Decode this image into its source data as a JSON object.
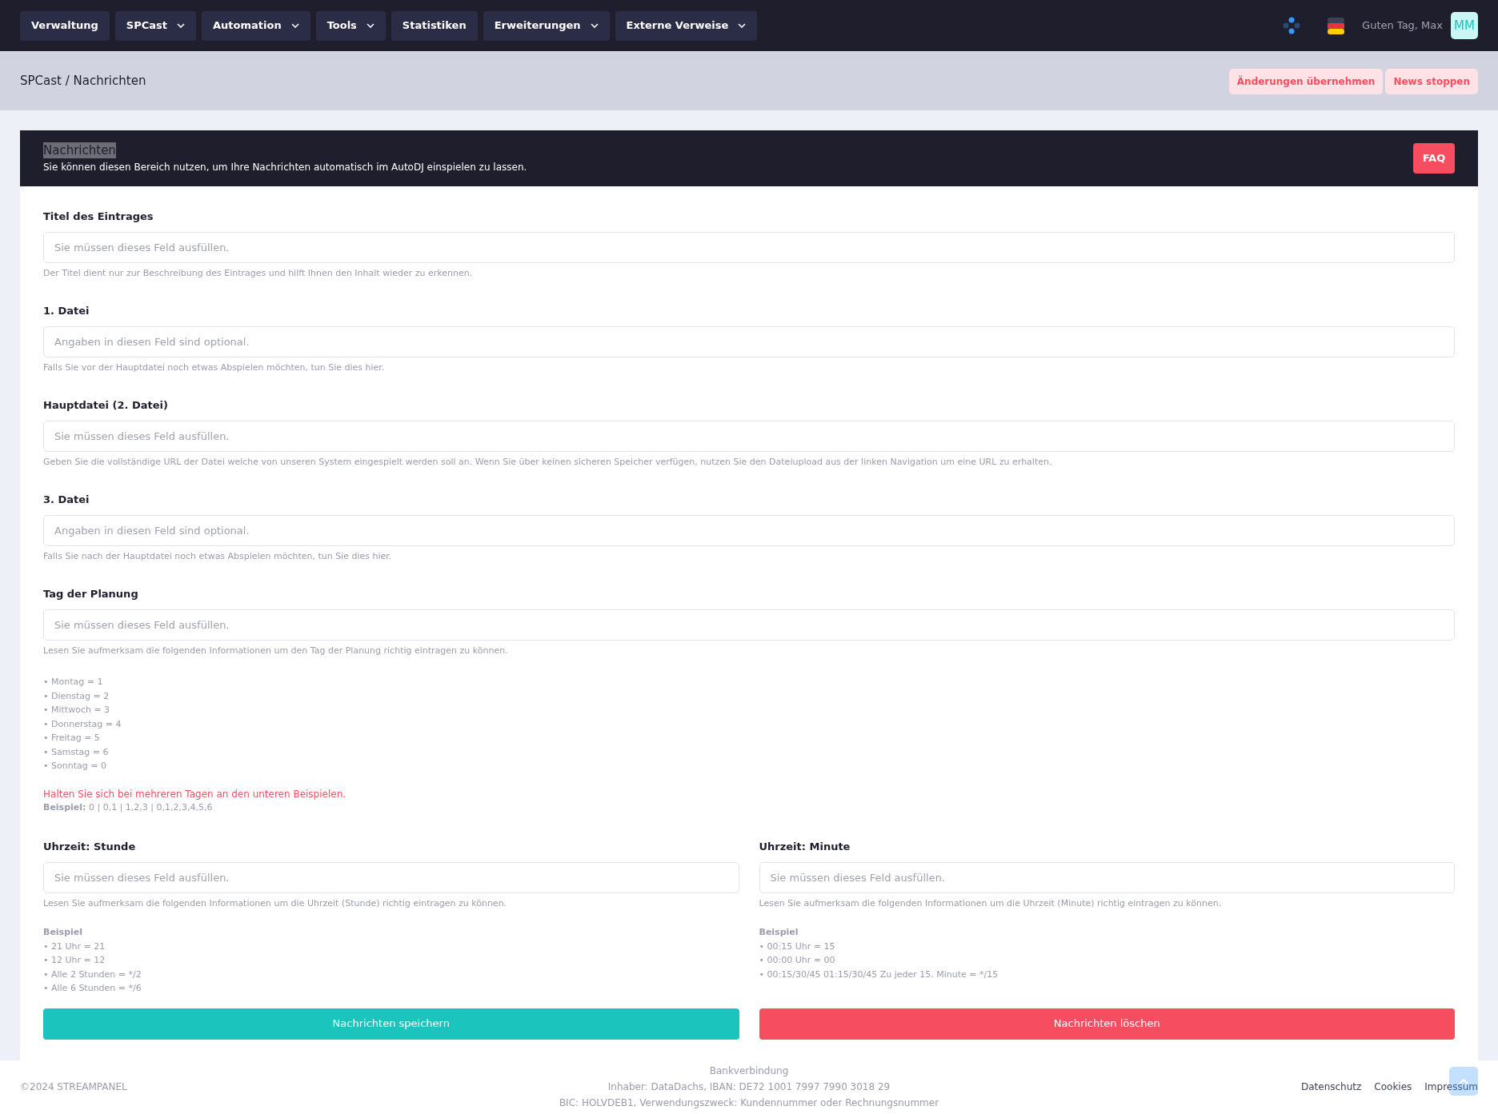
{
  "nav": {
    "items": [
      {
        "label": "Verwaltung",
        "dropdown": false
      },
      {
        "label": "SPCast",
        "dropdown": true
      },
      {
        "label": "Automation",
        "dropdown": true
      },
      {
        "label": "Tools",
        "dropdown": true
      },
      {
        "label": "Statistiken",
        "dropdown": false
      },
      {
        "label": "Erweiterungen",
        "dropdown": true
      },
      {
        "label": "Externe Verweise",
        "dropdown": true
      }
    ],
    "greeting": "Guten Tag, Max",
    "avatar": "MM"
  },
  "breadcrumb": "SPCast / Nachrichten",
  "actions": [
    "Änderungen übernehmen",
    "News stoppen"
  ],
  "card": {
    "title": "Nachrichten",
    "title_highlighted": true,
    "subtitle": "Sie können diesen Bereich nutzen, um Ihre Nachrichten automatisch im AutoDJ einspielen zu lassen.",
    "faq": "FAQ"
  },
  "fields": [
    {
      "label": "Titel des Eintrages",
      "placeholder": "Sie müssen dieses Feld ausfüllen.",
      "help": "Der Titel dient nur zur Beschreibung des Eintrages und hilft Ihnen den Inhalt wieder zu erkennen."
    },
    {
      "label": "1. Datei",
      "placeholder": "Angaben in diesen Feld sind optional.",
      "help": "Falls Sie vor der Hauptdatei noch etwas Abspielen möchten, tun Sie dies hier."
    },
    {
      "label": "Hauptdatei (2. Datei)",
      "placeholder": "Sie müssen dieses Feld ausfüllen.",
      "help": "Geben Sie die vollständige URL der Datei welche von unseren System eingespielt werden soll an. Wenn Sie über keinen sicheren Speicher verfügen, nutzen Sie den Dateiupload aus der linken Navigation um eine URL zu erhalten."
    },
    {
      "label": "3. Datei",
      "placeholder": "Angaben in diesen Feld sind optional.",
      "help": "Falls Sie nach der Hauptdatei noch etwas Abspielen möchten, tun Sie dies hier."
    },
    {
      "label": "Tag der Planung",
      "placeholder": "Sie müssen dieses Feld ausfüllen.",
      "help": "Lesen Sie aufmerksam die folgenden Informationen um den Tag der Planung richtig eintragen zu können."
    }
  ],
  "days": [
    "• Montag = 1",
    "• Dienstag = 2",
    "• Mittwoch = 3",
    "• Donnerstag = 4",
    "• Freitag = 5",
    "• Samstag = 6",
    "• Sonntag = 0"
  ],
  "warning": "Halten Sie sich bei mehreren Tagen an den unteren Beispielen.",
  "example": "**Beispiel:** 0 | 0,1 | 1,2,3 | 0,1,2,3,4,5,6",
  "time_fields": [
    {
      "label": "Uhrzeit: Stunde",
      "placeholder": "Sie müssen dieses Feld ausfüllen.",
      "help": "Lesen Sie aufmerksam die folgenden Informationen um die Uhrzeit (Stunde) richtig eintragen zu können.",
      "example_title": "Beispiel",
      "examples": [
        "• 21 Uhr = 21",
        "• 12 Uhr = 12",
        "• Alle 2 Stunden = */2",
        "• Alle 6 Stunden = */6"
      ]
    },
    {
      "label": "Uhrzeit: Minute",
      "placeholder": "Sie müssen dieses Feld ausfüllen.",
      "help": "Lesen Sie aufmerksam die folgenden Informationen um die Uhrzeit (Minute) richtig eintragen zu können.",
      "example_title": "Beispiel",
      "examples": [
        "• 00:15 Uhr = 15",
        "• 00:00 Uhr = 00",
        "• 00:15/30/45 01:15/30/45 Zu jeder 15. Minute = */15"
      ]
    }
  ],
  "buttons": [
    {
      "label": "Nachrichten speichern",
      "kind": "save"
    },
    {
      "label": "Nachrichten löschen",
      "kind": "delete"
    }
  ],
  "footer": {
    "copyright": "©2024 STREAMPANEL",
    "bank": [
      "Bankverbindung",
      "Inhaber: DataDachs, IBAN: DE72 1001 7997 7990 3018 29",
      "BIC: HOLVDEB1, Verwendungszweck: Kundennummer oder Rechnungsnummer"
    ],
    "links": [
      "Datenschutz",
      "Cookies",
      "Impressum"
    ]
  }
}
